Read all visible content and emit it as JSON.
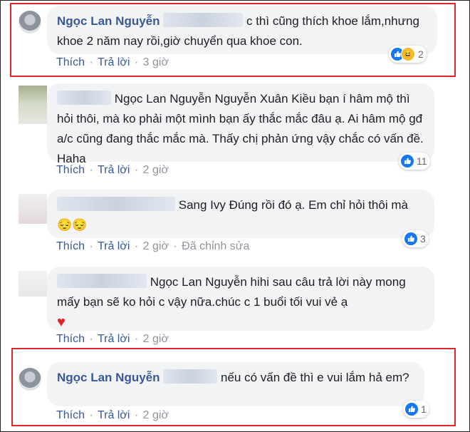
{
  "colors": {
    "author": "#385898",
    "bubble": "#f2f3f5",
    "highlight": "#e0242e",
    "like": "#1877f2"
  },
  "actions": {
    "like": "Thích",
    "reply": "Trả lời",
    "dot": "·",
    "edited": "Đã chỉnh sửa"
  },
  "comments": [
    {
      "author": "Ngọc Lan Nguyễn",
      "text": "c thì cũng thích khoe lắm,nhưng khoe 2 năm nay rồi,giờ chuyển qua khoe con.",
      "time": "3 giờ",
      "reactions": "2"
    },
    {
      "text": "Ngọc Lan Nguyễn Nguyễn Xuân Kiều bạn í hâm mộ thì hỏi thôi, mà ko phải một mình bạn ấy thắc mắc đâu ạ. Ai hâm mộ gđ a/c cũng đang thắc mắc mà. Thấy chị phản ứng vậy chắc có vấn đề. Haha",
      "time": "2 giờ",
      "reactions": "11"
    },
    {
      "text": "Sang Ivy Đúng rồi đó ạ. Em chỉ hỏi thôi mà 😔😔",
      "time": "2 giờ",
      "reactions": "3"
    },
    {
      "text": "Ngọc Lan Nguyễn hihi sau câu trả lời này mong mấy bạn sẽ ko hỏi c vậy nữa.chúc c 1 buổi tối vui vẻ ạ",
      "heart": "♥",
      "time": "2 giờ"
    },
    {
      "author": "Ngọc Lan Nguyễn",
      "text": "nếu có vấn đề thì e vui lắm hả em?",
      "time": "2 giờ",
      "reactions": "1"
    }
  ]
}
